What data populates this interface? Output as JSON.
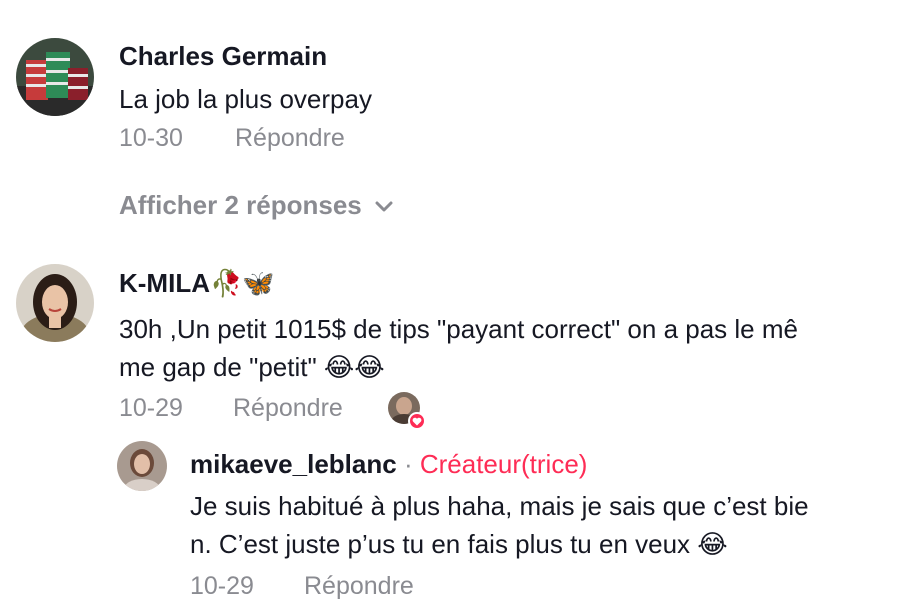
{
  "comments": [
    {
      "username": "Charles Germain",
      "text_lines": [
        "La job la plus overpay"
      ],
      "date": "10-30",
      "reply_label": "Répondre",
      "avatar_icon": "poker-chips-avatar"
    },
    {
      "username": "K-MILA🥀🦋",
      "text_lines": [
        "30h ,Un petit 1015$ de tips \"payant correct\" on a pas le mê",
        "me gap de \"petit\" 😂😂"
      ],
      "date": "10-29",
      "reply_label": "Répondre",
      "avatar_icon": "profile-photo-avatar",
      "liked_by_creator_icon": "heart-icon"
    }
  ],
  "view_replies_label": "Afficher 2 réponses",
  "reply": {
    "username": "mikaeve_leblanc",
    "separator": "·",
    "creator_label": "Créateur(trice)",
    "text_lines": [
      "Je suis habitué à plus haha, mais je sais que c’est bie",
      "n. C’est juste p’us tu en fais plus tu en veux 😂"
    ],
    "date": "10-29",
    "reply_label": "Répondre",
    "avatar_icon": "creator-avatar"
  },
  "colors": {
    "text": "#161823",
    "secondary": "#8a8b91",
    "accent": "#fe2c55"
  }
}
